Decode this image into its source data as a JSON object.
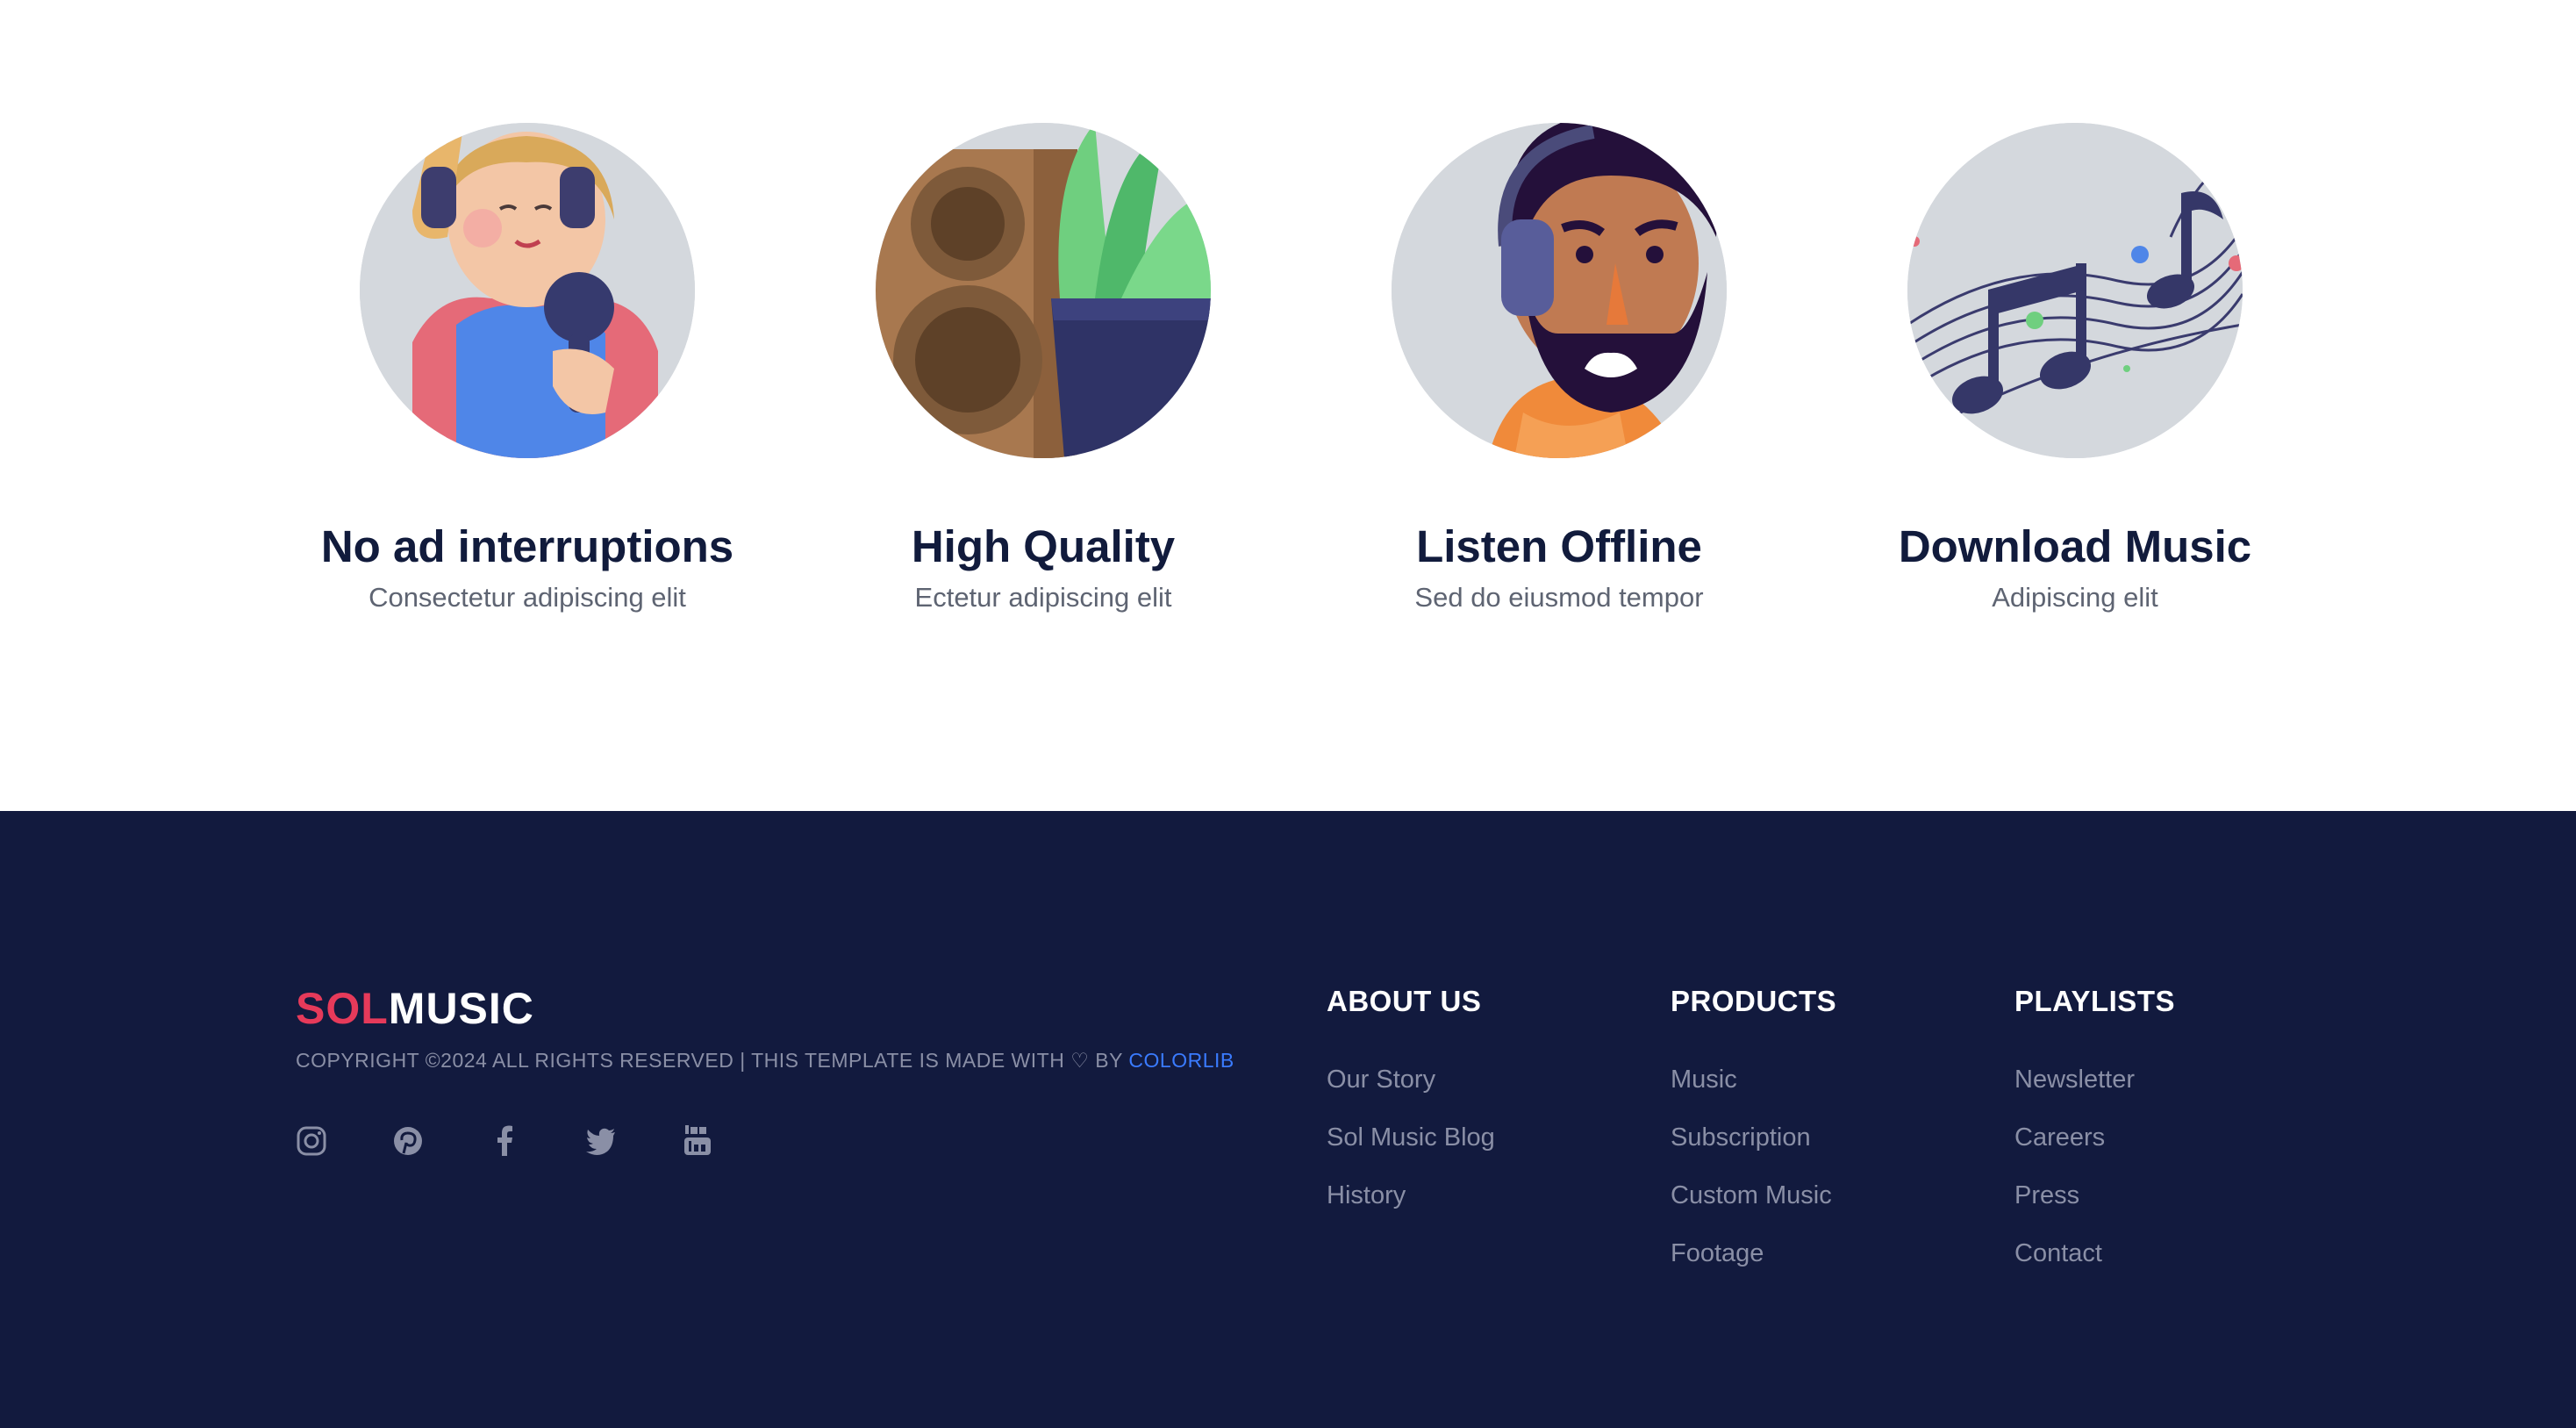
{
  "features": [
    {
      "title": "No ad interruptions",
      "subtitle": "Consectetur adipiscing elit",
      "icon": "singer-illustration"
    },
    {
      "title": "High Quality",
      "subtitle": "Ectetur adipiscing elit",
      "icon": "speaker-plant-illustration"
    },
    {
      "title": "Listen Offline",
      "subtitle": "Sed do eiusmod tempor",
      "icon": "headphones-man-illustration"
    },
    {
      "title": "Download Music",
      "subtitle": "Adipiscing elit",
      "icon": "music-notes-illustration"
    }
  ],
  "footer": {
    "logo": {
      "part1": "SOL",
      "part2": "MUSIC"
    },
    "copyright": {
      "text": "COPYRIGHT ©2024 ALL RIGHTS RESERVED | THIS TEMPLATE IS MADE WITH",
      "heart": "♡",
      "by": "BY",
      "link": "COLORLIB"
    },
    "social": [
      "instagram-icon",
      "pinterest-icon",
      "facebook-icon",
      "twitter-icon",
      "youtube-icon"
    ],
    "columns": [
      {
        "title": "ABOUT US",
        "links": [
          "Our Story",
          "Sol Music Blog",
          "History"
        ]
      },
      {
        "title": "PRODUCTS",
        "links": [
          "Music",
          "Subscription",
          "Custom Music",
          "Footage"
        ]
      },
      {
        "title": "PLAYLISTS",
        "links": [
          "Newsletter",
          "Careers",
          "Press",
          "Contact"
        ]
      }
    ]
  },
  "colors": {
    "footer_bg": "#121a3e",
    "accent_red": "#e63a5a",
    "link_blue": "#3a7bff",
    "heading_dark": "#111b3c",
    "muted_text": "#8a8fa6"
  }
}
